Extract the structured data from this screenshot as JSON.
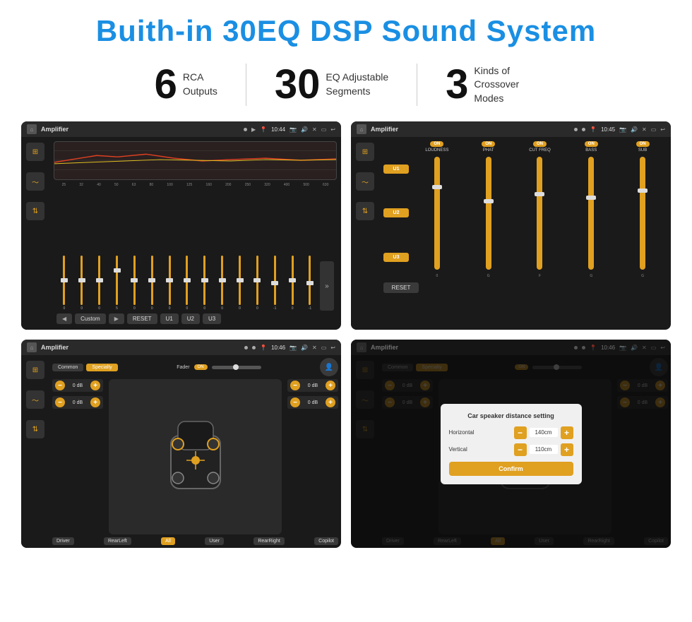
{
  "title": "Buith-in 30EQ DSP Sound System",
  "stats": [
    {
      "number": "6",
      "desc_line1": "RCA",
      "desc_line2": "Outputs"
    },
    {
      "number": "30",
      "desc_line1": "EQ Adjustable",
      "desc_line2": "Segments"
    },
    {
      "number": "3",
      "desc_line1": "Kinds of",
      "desc_line2": "Crossover Modes"
    }
  ],
  "screens": {
    "eq": {
      "title": "Amplifier",
      "time": "10:44",
      "freq_labels": [
        "25",
        "32",
        "40",
        "50",
        "63",
        "80",
        "100",
        "125",
        "160",
        "200",
        "250",
        "320",
        "400",
        "500",
        "630"
      ],
      "slider_values": [
        "0",
        "0",
        "0",
        "5",
        "0",
        "0",
        "0",
        "0",
        "0",
        "0",
        "0",
        "0",
        "-1",
        "0",
        "-1"
      ],
      "bottom_buttons": [
        "Custom",
        "RESET",
        "U1",
        "U2",
        "U3"
      ]
    },
    "crossover": {
      "title": "Amplifier",
      "time": "10:45",
      "presets": [
        "U1",
        "U2",
        "U3"
      ],
      "channels": [
        "LOUDNESS",
        "PHAT",
        "CUT FREQ",
        "BASS",
        "SUB"
      ],
      "reset_label": "RESET"
    },
    "speaker_fader": {
      "title": "Amplifier",
      "time": "10:46",
      "tabs": [
        "Common",
        "Specialty"
      ],
      "fader_label": "Fader",
      "fader_on": "ON",
      "vol_values": [
        "0 dB",
        "0 dB",
        "0 dB",
        "0 dB"
      ],
      "bottom_labels": [
        "Driver",
        "RearLeft",
        "All",
        "User",
        "RearRight",
        "Copilot"
      ]
    },
    "speaker_distance": {
      "title": "Amplifier",
      "time": "10:46",
      "tabs": [
        "Common",
        "Specialty"
      ],
      "dialog_title": "Car speaker distance setting",
      "horizontal_label": "Horizontal",
      "horizontal_value": "140cm",
      "vertical_label": "Vertical",
      "vertical_value": "110cm",
      "confirm_label": "Confirm",
      "vol_values": [
        "0 dB",
        "0 dB"
      ],
      "bottom_labels": [
        "Driver",
        "RearLeft",
        "All",
        "User",
        "RearRight",
        "Copilot"
      ]
    }
  }
}
